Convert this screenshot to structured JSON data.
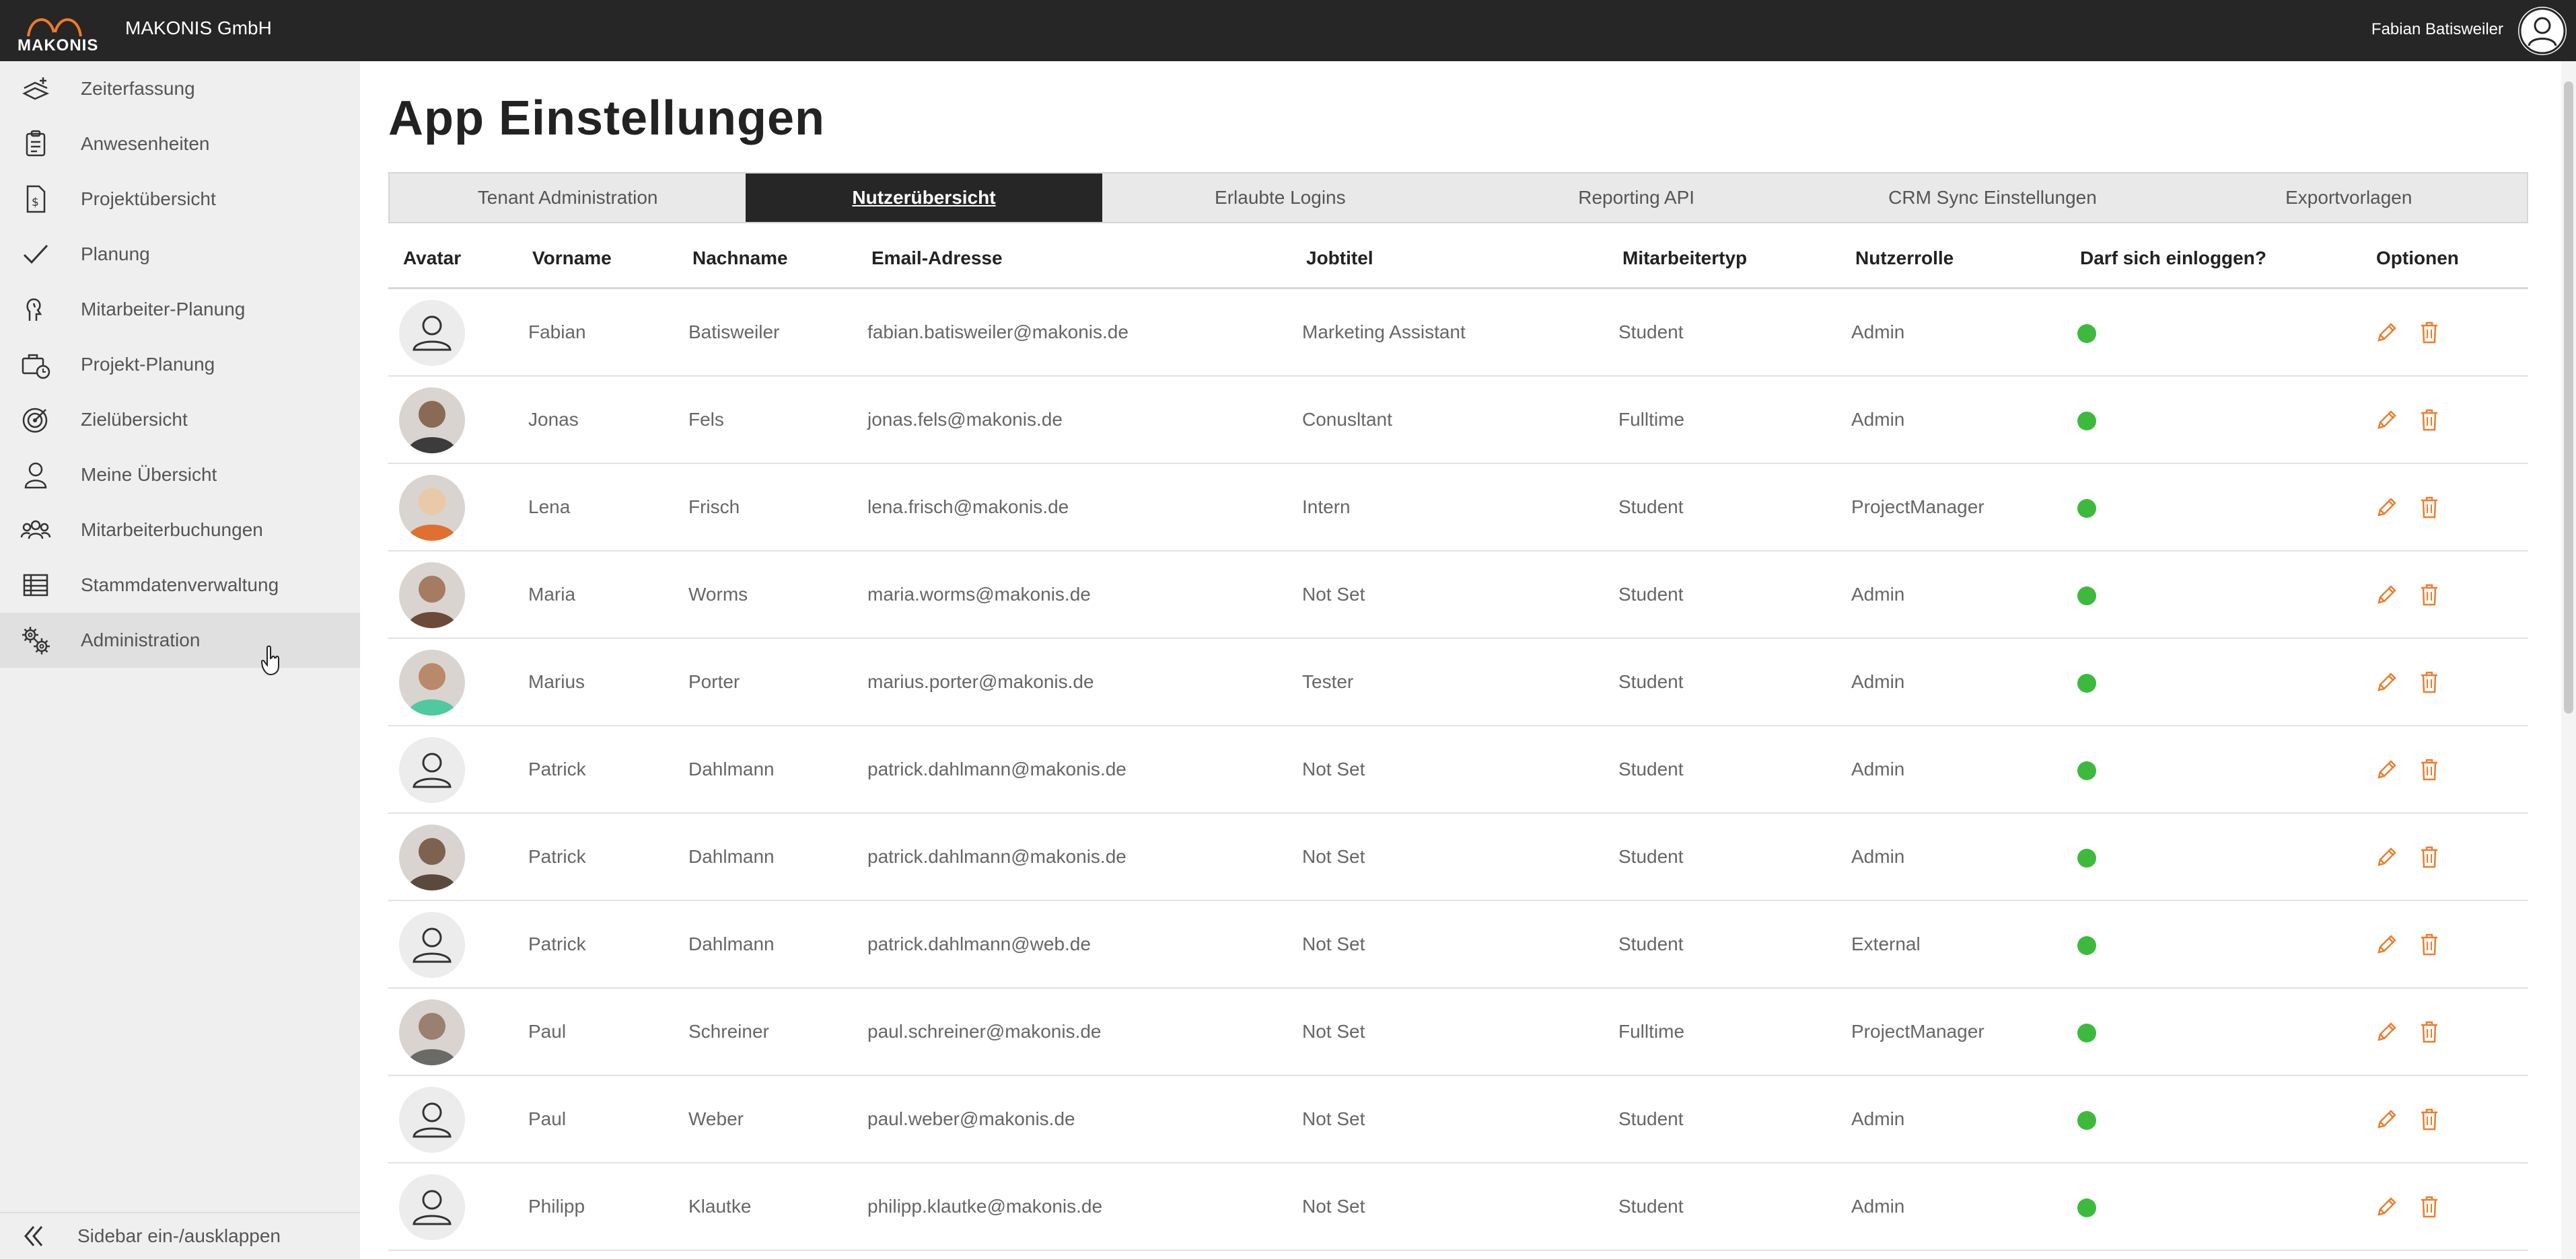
{
  "header": {
    "logo_text": "MAKONIS",
    "company": "MAKONIS GmbH",
    "user_name": "Fabian Batisweiler"
  },
  "sidebar": {
    "items": [
      {
        "label": "Zeiterfassung",
        "icon": "time-tracking-icon"
      },
      {
        "label": "Anwesenheiten",
        "icon": "clipboard-icon"
      },
      {
        "label": "Projektübersicht",
        "icon": "project-document-icon"
      },
      {
        "label": "Planung",
        "icon": "checkmark-icon"
      },
      {
        "label": "Mitarbeiter-Planung",
        "icon": "employee-planning-icon"
      },
      {
        "label": "Projekt-Planung",
        "icon": "briefcase-clock-icon"
      },
      {
        "label": "Zielübersicht",
        "icon": "target-icon"
      },
      {
        "label": "Meine Übersicht",
        "icon": "person-icon"
      },
      {
        "label": "Mitarbeiterbuchungen",
        "icon": "group-icon"
      },
      {
        "label": "Stammdatenverwaltung",
        "icon": "table-icon"
      },
      {
        "label": "Administration",
        "icon": "gears-icon"
      }
    ],
    "active_index": 10,
    "toggle_label": "Sidebar ein-/ausklappen"
  },
  "main": {
    "title": "App Einstellungen",
    "tabs": [
      {
        "label": "Tenant Administration"
      },
      {
        "label": "Nutzerübersicht"
      },
      {
        "label": "Erlaubte Logins"
      },
      {
        "label": "Reporting API"
      },
      {
        "label": "CRM Sync Einstellungen"
      },
      {
        "label": "Exportvorlagen"
      }
    ],
    "active_tab": 1,
    "table": {
      "columns": [
        "Avatar",
        "Vorname",
        "Nachname",
        "Email-Adresse",
        "Jobtitel",
        "Mitarbeitertyp",
        "Nutzerrolle",
        "Darf sich einloggen?",
        "Optionen"
      ],
      "rows": [
        {
          "first": "Fabian",
          "last": "Batisweiler",
          "email": "fabian.batisweiler@makonis.de",
          "job": "Marketing Assistant",
          "type": "Student",
          "role": "Admin",
          "avatar": "placeholder",
          "can_login": true
        },
        {
          "first": "Jonas",
          "last": "Fels",
          "email": "jonas.fels@makonis.de",
          "job": "Conusltant",
          "type": "Fulltime",
          "role": "Admin",
          "avatar": "photo",
          "can_login": true
        },
        {
          "first": "Lena",
          "last": "Frisch",
          "email": "lena.frisch@makonis.de",
          "job": "Intern",
          "type": "Student",
          "role": "ProjectManager",
          "avatar": "photo",
          "can_login": true
        },
        {
          "first": "Maria",
          "last": "Worms",
          "email": "maria.worms@makonis.de",
          "job": "Not Set",
          "type": "Student",
          "role": "Admin",
          "avatar": "photo",
          "can_login": true
        },
        {
          "first": "Marius",
          "last": "Porter",
          "email": "marius.porter@makonis.de",
          "job": "Tester",
          "type": "Student",
          "role": "Admin",
          "avatar": "photo",
          "can_login": true
        },
        {
          "first": "Patrick",
          "last": "Dahlmann",
          "email": "patrick.dahlmann@makonis.de",
          "job": "Not Set",
          "type": "Student",
          "role": "Admin",
          "avatar": "placeholder",
          "can_login": true
        },
        {
          "first": "Patrick",
          "last": "Dahlmann",
          "email": "patrick.dahlmann@makonis.de",
          "job": "Not Set",
          "type": "Student",
          "role": "Admin",
          "avatar": "photo",
          "can_login": true
        },
        {
          "first": "Patrick",
          "last": "Dahlmann",
          "email": "patrick.dahlmann@web.de",
          "job": "Not Set",
          "type": "Student",
          "role": "External",
          "avatar": "placeholder",
          "can_login": true
        },
        {
          "first": "Paul",
          "last": "Schreiner",
          "email": "paul.schreiner@makonis.de",
          "job": "Not Set",
          "type": "Fulltime",
          "role": "ProjectManager",
          "avatar": "photo",
          "can_login": true
        },
        {
          "first": "Paul",
          "last": "Weber",
          "email": "paul.weber@makonis.de",
          "job": "Not Set",
          "type": "Student",
          "role": "Admin",
          "avatar": "placeholder",
          "can_login": true
        },
        {
          "first": "Philipp",
          "last": "Klautke",
          "email": "philipp.klautke@makonis.de",
          "job": "Not Set",
          "type": "Student",
          "role": "Admin",
          "avatar": "placeholder",
          "can_login": true
        }
      ]
    }
  },
  "colors": {
    "topbar": "#262626",
    "sidebar": "#efefef",
    "active_tab": "#262626",
    "status_ok": "#3dba3d",
    "action_icon": "#f07b2a",
    "logo_arc": "#f07b2a"
  }
}
